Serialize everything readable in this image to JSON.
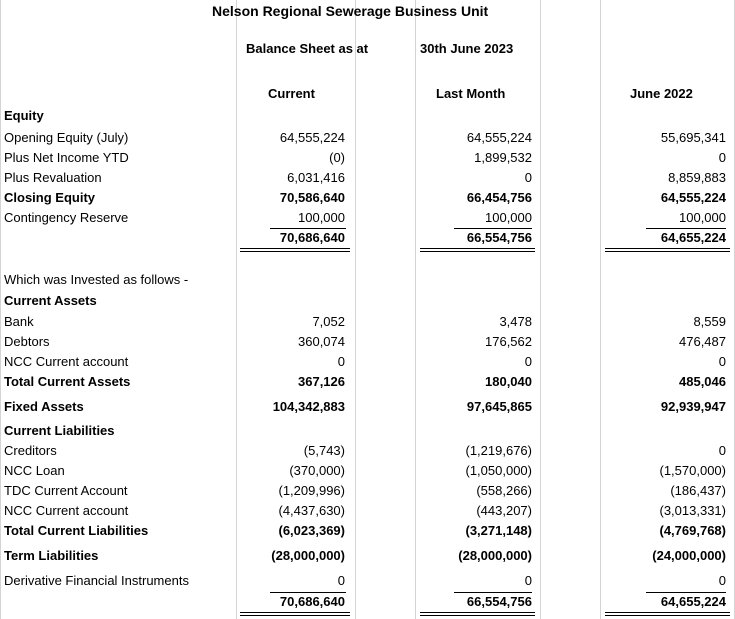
{
  "title": "Nelson Regional Sewerage Business Unit",
  "subtitle": {
    "label": "Balance Sheet as at",
    "date": "30th June 2023"
  },
  "columns": {
    "current": "Current",
    "last_month": "Last Month",
    "june_2022": "June 2022"
  },
  "rows": [
    {
      "label": "Equity",
      "bold": true,
      "current": "",
      "last_month": "",
      "june_2022": ""
    },
    {
      "label": "Opening Equity (July)",
      "bold": false,
      "current": "64,555,224",
      "last_month": "64,555,224",
      "june_2022": "55,695,341"
    },
    {
      "label": "Plus Net Income YTD",
      "bold": false,
      "current": "(0)",
      "last_month": "1,899,532",
      "june_2022": "0"
    },
    {
      "label": "Plus Revaluation",
      "bold": false,
      "current": "6,031,416",
      "last_month": "0",
      "june_2022": "8,859,883"
    },
    {
      "label": "Closing Equity",
      "bold": true,
      "current": "70,586,640",
      "last_month": "66,454,756",
      "june_2022": "64,555,224"
    },
    {
      "label": "Contingency Reserve",
      "bold": false,
      "current": "100,000",
      "last_month": "100,000",
      "june_2022": "100,000"
    },
    {
      "label": "",
      "bold": true,
      "current": "70,686,640",
      "last_month": "66,554,756",
      "june_2022": "64,655,224"
    },
    {
      "label": "Which was Invested as follows -",
      "bold": false,
      "current": "",
      "last_month": "",
      "june_2022": ""
    },
    {
      "label": "Current Assets",
      "bold": true,
      "current": "",
      "last_month": "",
      "june_2022": ""
    },
    {
      "label": "Bank",
      "bold": false,
      "current": "7,052",
      "last_month": "3,478",
      "june_2022": "8,559"
    },
    {
      "label": "Debtors",
      "bold": false,
      "current": "360,074",
      "last_month": "176,562",
      "june_2022": "476,487"
    },
    {
      "label": "NCC Current account",
      "bold": false,
      "current": "0",
      "last_month": "0",
      "june_2022": "0"
    },
    {
      "label": "Total Current Assets",
      "bold": true,
      "current": "367,126",
      "last_month": "180,040",
      "june_2022": "485,046"
    },
    {
      "label": "Fixed Assets",
      "bold": true,
      "current": "104,342,883",
      "last_month": "97,645,865",
      "june_2022": "92,939,947"
    },
    {
      "label": "Current Liabilities",
      "bold": true,
      "current": "",
      "last_month": "",
      "june_2022": ""
    },
    {
      "label": "Creditors",
      "bold": false,
      "current": "(5,743)",
      "last_month": "(1,219,676)",
      "june_2022": "0"
    },
    {
      "label": "NCC Loan",
      "bold": false,
      "current": "(370,000)",
      "last_month": "(1,050,000)",
      "june_2022": "(1,570,000)"
    },
    {
      "label": "TDC Current Account",
      "bold": false,
      "current": "(1,209,996)",
      "last_month": "(558,266)",
      "june_2022": "(186,437)"
    },
    {
      "label": "NCC Current account",
      "bold": false,
      "current": "(4,437,630)",
      "last_month": "(443,207)",
      "june_2022": "(3,013,331)"
    },
    {
      "label": "Total Current Liabilities",
      "bold": true,
      "current": "(6,023,369)",
      "last_month": "(3,271,148)",
      "june_2022": "(4,769,768)"
    },
    {
      "label": "Term Liabilities",
      "bold": true,
      "current": "(28,000,000)",
      "last_month": "(28,000,000)",
      "june_2022": "(24,000,000)"
    },
    {
      "label": "Derivative Financial Instruments",
      "bold": false,
      "current": "0",
      "last_month": "0",
      "june_2022": "0"
    },
    {
      "label": "",
      "bold": true,
      "current": "70,686,640",
      "last_month": "66,554,756",
      "june_2022": "64,655,224"
    }
  ]
}
